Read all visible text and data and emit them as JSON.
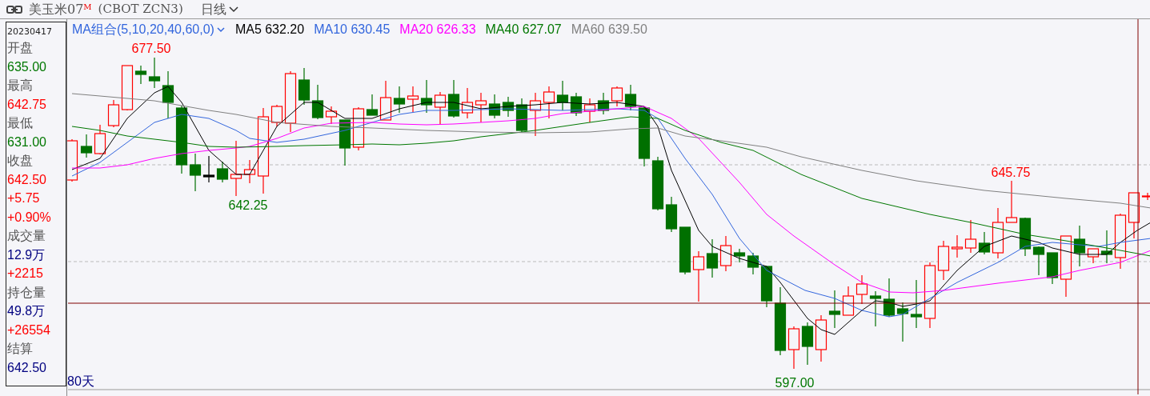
{
  "title_bar": {
    "instrument": "美玉米07",
    "superscript": "M",
    "code": "(CBOT ZCN3)",
    "period": "日线"
  },
  "info_panel": {
    "date": "20230417",
    "items": [
      {
        "text": "开盘",
        "kind": "label"
      },
      {
        "text": "635.00",
        "kind": "down"
      },
      {
        "text": "最高",
        "kind": "label"
      },
      {
        "text": "642.75",
        "kind": "up"
      },
      {
        "text": "最低",
        "kind": "label"
      },
      {
        "text": "631.00",
        "kind": "down"
      },
      {
        "text": "收盘",
        "kind": "label"
      },
      {
        "text": "642.50",
        "kind": "up"
      },
      {
        "text": "+5.75",
        "kind": "up"
      },
      {
        "text": "+0.90%",
        "kind": "up"
      },
      {
        "text": "成交量",
        "kind": "label"
      },
      {
        "text": "12.9万",
        "kind": "plain"
      },
      {
        "text": "+2215",
        "kind": "up"
      },
      {
        "text": "持仓量",
        "kind": "label"
      },
      {
        "text": "49.8万",
        "kind": "plain"
      },
      {
        "text": "+26554",
        "kind": "up"
      },
      {
        "text": "结算",
        "kind": "label"
      },
      {
        "text": "642.50",
        "kind": "plain"
      }
    ]
  },
  "indicator": {
    "selector": "MA组合(5,10,20,40,60,0)",
    "lines": [
      {
        "label": "MA5 632.20",
        "color": "#000000"
      },
      {
        "label": "MA10 630.45",
        "color": "#3366dd"
      },
      {
        "label": "MA20 626.33",
        "color": "#ff00ff"
      },
      {
        "label": "MA40 627.07",
        "color": "#007700"
      },
      {
        "label": "MA60 639.50",
        "color": "#808080"
      }
    ]
  },
  "chart": {
    "price_labels": [
      {
        "text": "677.50",
        "kind": "up"
      },
      {
        "text": "642.25",
        "kind": "down"
      },
      {
        "text": "597.00",
        "kind": "down"
      },
      {
        "text": "645.75",
        "kind": "up"
      }
    ],
    "period_label": "80天"
  }
}
